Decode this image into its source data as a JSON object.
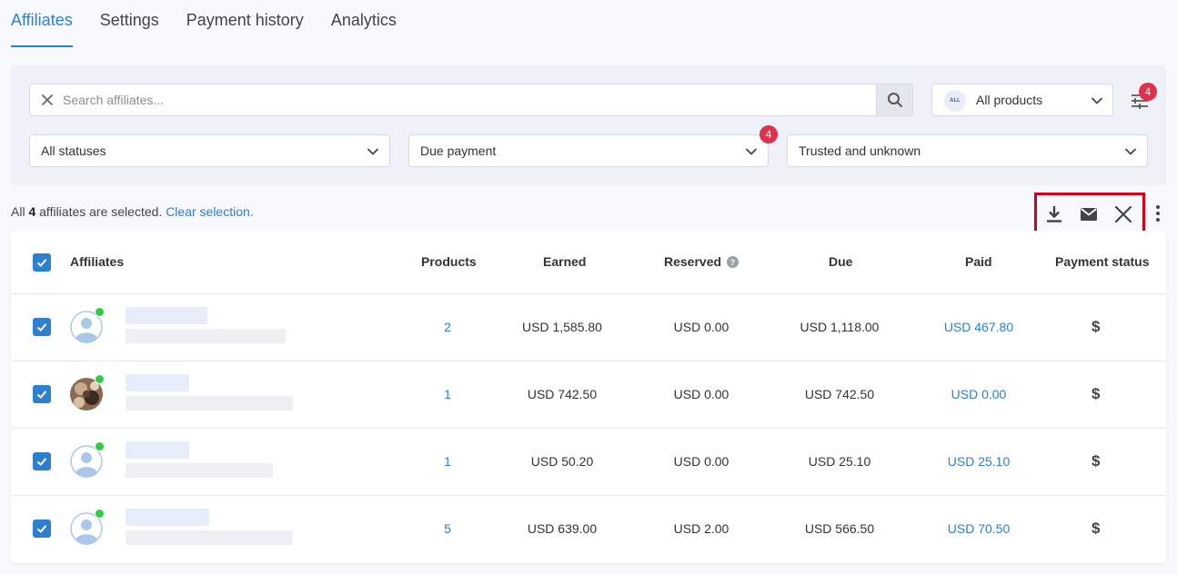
{
  "tabs": [
    "Affiliates",
    "Settings",
    "Payment history",
    "Analytics"
  ],
  "search": {
    "placeholder": "Search affiliates..."
  },
  "product_filter": {
    "badge": "ALL",
    "label": "All products"
  },
  "filter_badge_count": "4",
  "status_filter": "All statuses",
  "payment_filter": {
    "label": "Due payment",
    "badge": "4"
  },
  "trust_filter": "Trusted and unknown",
  "selection": {
    "prefix": "All ",
    "count": "4",
    "suffix": " affiliates are selected. ",
    "clear": "Clear selection."
  },
  "columns": {
    "affiliates": "Affiliates",
    "products": "Products",
    "earned": "Earned",
    "reserved": "Reserved",
    "due": "Due",
    "paid": "Paid",
    "payment_status": "Payment status"
  },
  "rows": [
    {
      "products": "2",
      "earned": "USD 1,585.80",
      "reserved": "USD 0.00",
      "due": "USD 1,118.00",
      "paid": "USD 467.80",
      "status_icon": "$",
      "avatar": "default"
    },
    {
      "products": "1",
      "earned": "USD 742.50",
      "reserved": "USD 0.00",
      "due": "USD 742.50",
      "paid": "USD 0.00",
      "status_icon": "$",
      "avatar": "photo"
    },
    {
      "products": "1",
      "earned": "USD 50.20",
      "reserved": "USD 0.00",
      "due": "USD 25.10",
      "paid": "USD 25.10",
      "status_icon": "$",
      "avatar": "default"
    },
    {
      "products": "5",
      "earned": "USD 639.00",
      "reserved": "USD 2.00",
      "due": "USD 566.50",
      "paid": "USD 70.50",
      "status_icon": "$",
      "avatar": "default"
    }
  ],
  "colors": {
    "accent": "#2d7fd0",
    "badge": "#e0314b",
    "online": "#2ecc40",
    "highlight_box": "#d0021b"
  }
}
